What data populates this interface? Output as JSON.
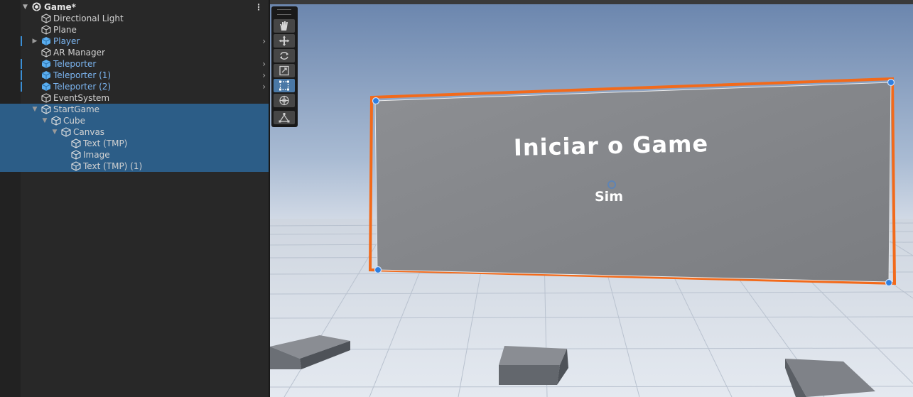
{
  "hierarchy": {
    "scene_title": "Game*",
    "items": [
      {
        "label": "Directional Light"
      },
      {
        "label": "Plane"
      },
      {
        "label": "Player"
      },
      {
        "label": "AR Manager"
      },
      {
        "label": "Teleporter"
      },
      {
        "label": "Teleporter (1)"
      },
      {
        "label": "Teleporter (2)"
      },
      {
        "label": "EventSystem"
      },
      {
        "label": "StartGame"
      },
      {
        "label": "Cube"
      },
      {
        "label": "Canvas"
      },
      {
        "label": "Text (TMP)"
      },
      {
        "label": "Image"
      },
      {
        "label": "Text (TMP) (1)"
      }
    ]
  },
  "scene_view": {
    "canvas_title": "Iniciar o Game",
    "canvas_button_text": "Sim"
  },
  "colors": {
    "selection": "#2c5d87",
    "prefab_text": "#7cb6f2",
    "selection_outline": "#f26a1b",
    "handle_blue": "#2f7fe0"
  },
  "tools": [
    "hand-tool",
    "move-tool",
    "rotate-tool",
    "scale-tool",
    "rect-tool",
    "transform-tool",
    "custom-tool"
  ]
}
